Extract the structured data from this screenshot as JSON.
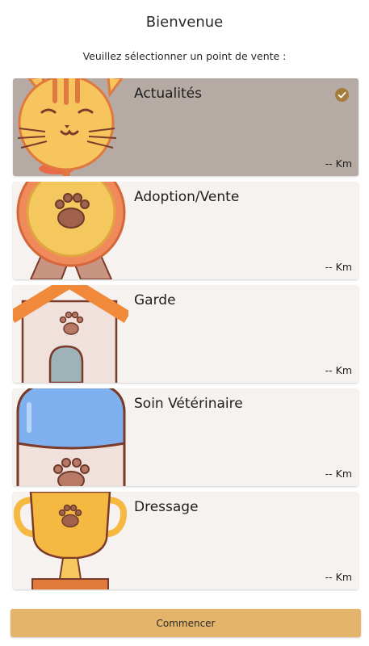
{
  "header": {
    "title": "Bienvenue",
    "subtitle": "Veuillez sélectionner un point de vente :"
  },
  "cards": [
    {
      "label": "Actualités",
      "distance": "-- Km",
      "selected": true,
      "icon": "cat-icon"
    },
    {
      "label": "Adoption/Vente",
      "distance": "-- Km",
      "selected": false,
      "icon": "paw-medal-icon"
    },
    {
      "label": "Garde",
      "distance": "-- Km",
      "selected": false,
      "icon": "dog-house-icon"
    },
    {
      "label": "Soin Vétérinaire",
      "distance": "-- Km",
      "selected": false,
      "icon": "vet-bottle-icon"
    },
    {
      "label": "Dressage",
      "distance": "-- Km",
      "selected": false,
      "icon": "trophy-icon"
    }
  ],
  "footer": {
    "button_label": "Commencer"
  },
  "colors": {
    "selected_card": "#b5aaa4",
    "card": "#f6f2f0",
    "button": "#e4b46a",
    "check": "#a67c3d"
  }
}
